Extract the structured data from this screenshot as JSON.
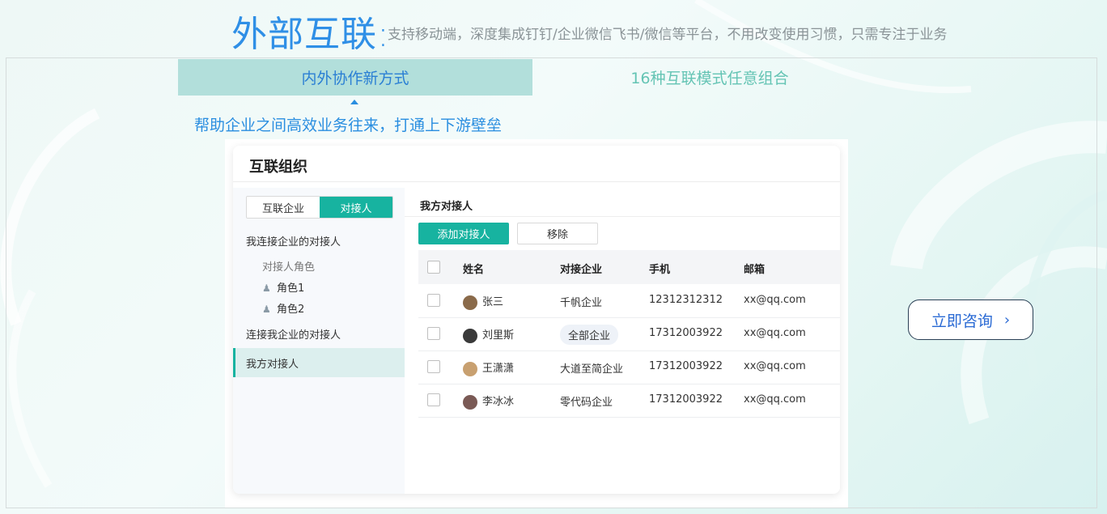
{
  "header": {
    "title": "外部互联:",
    "subtitle": "支持移动端，深度集成钉钉/企业微信飞书/微信等平台，不用改变使用习惯，只需专注于业务"
  },
  "tabs": [
    {
      "label": "内外协作新方式",
      "active": true
    },
    {
      "label": "16种互联模式任意组合",
      "active": false
    }
  ],
  "tagline": "帮助企业之间高效业务往来，打通上下游壁垒",
  "app": {
    "title": "互联组织",
    "segment": {
      "left": "互联企业",
      "right": "对接人",
      "selected": "对接人"
    },
    "sidebar": {
      "group1": "我连接企业的对接人",
      "sub_header": "对接人角色",
      "roles": [
        "角色1",
        "角色2"
      ],
      "group2": "连接我企业的对接人",
      "group3": "我方对接人"
    },
    "main": {
      "heading": "我方对接人",
      "add_button": "添加对接人",
      "remove_button": "移除",
      "columns": [
        "姓名",
        "对接企业",
        "手机",
        "邮箱"
      ],
      "rows": [
        {
          "name": "张三",
          "company": "千帆企业",
          "phone": "12312312312",
          "email": "xx@qq.com"
        },
        {
          "name": "刘里斯",
          "company": "全部企业",
          "phone": "17312003922",
          "email": "xx@qq.com"
        },
        {
          "name": "王潇潇",
          "company": "大道至简企业",
          "phone": "17312003922",
          "email": "xx@qq.com"
        },
        {
          "name": "李冰冰",
          "company": "零代码企业",
          "phone": "17312003922",
          "email": "xx@qq.com"
        }
      ]
    }
  },
  "cta": {
    "label": "立即咨询",
    "icon": "chevron-right-icon"
  },
  "colors": {
    "accent": "#17b3a0",
    "title_blue": "#2f8fe6",
    "tab_bg": "#b2dfdb"
  }
}
